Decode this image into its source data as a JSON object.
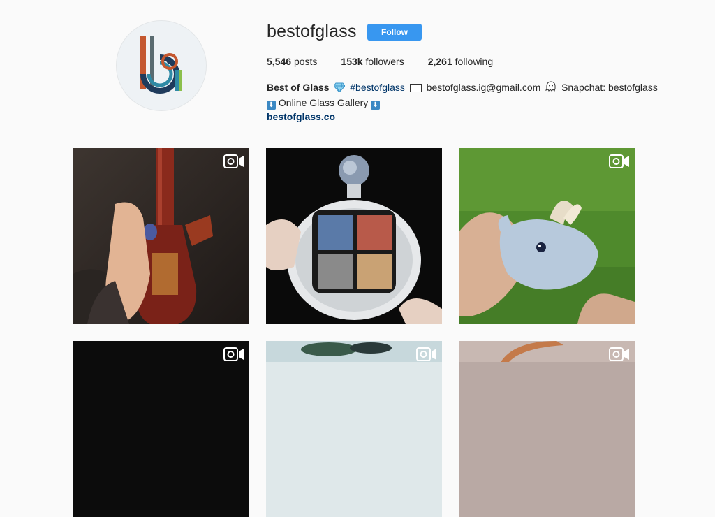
{
  "profile": {
    "username": "bestofglass",
    "follow_label": "Follow",
    "stats": [
      {
        "count": "5,546",
        "label": "posts"
      },
      {
        "count": "153k",
        "label": "followers"
      },
      {
        "count": "2,261",
        "label": "following"
      }
    ],
    "bio": {
      "name": "Best of Glass",
      "hashtag": "#bestofglass",
      "email": "bestofglass.ig@gmail.com",
      "snapchat": "Snapchat: bestofglass",
      "line2": "Online Glass Gallery",
      "website": "bestofglass.co"
    }
  },
  "icons": {
    "gem": "gem-icon",
    "envelope": "envelope-icon",
    "ghost": "ghost-icon",
    "down_arrow": "down-arrow-icon",
    "video": "video-camera-icon"
  },
  "colors": {
    "follow_button": "#3897f0",
    "link": "#003569",
    "background": "#fafafa"
  }
}
